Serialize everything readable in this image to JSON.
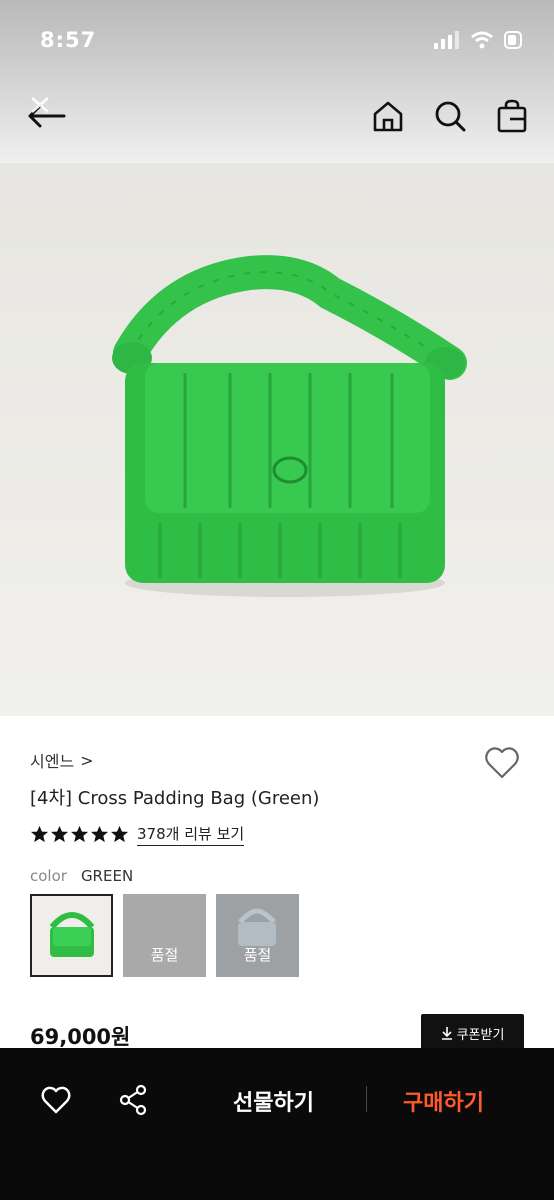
{
  "status_bar": {
    "time": "8:57"
  },
  "nav": {
    "back_icon": "back-arrow-icon",
    "home_icon": "home-icon",
    "search_icon": "search-icon",
    "bag_icon": "shopping-bag-icon"
  },
  "product": {
    "image": "green-padded-bag-photo",
    "brand": "시엔느",
    "brand_chevron": ">",
    "title": "[4차] Cross Padding Bag (Green)",
    "rating_stars": 5,
    "reviews_label": "378개 리뷰 보기",
    "color_label": "color",
    "color_value": "GREEN",
    "swatches": [
      {
        "name": "green",
        "sold_out": false,
        "label": ""
      },
      {
        "name": "grey",
        "sold_out": true,
        "label": "품절"
      },
      {
        "name": "blue-grey",
        "sold_out": true,
        "label": "품절"
      }
    ],
    "price": "69,000원",
    "coupon_label": "쿠폰받기"
  },
  "bottom_bar": {
    "gift_label": "선물하기",
    "buy_label": "구매하기",
    "buy_color": "#ff5a2b"
  },
  "colors": {
    "bag_green": "#2ec245",
    "dark": "#0a0a0a"
  }
}
